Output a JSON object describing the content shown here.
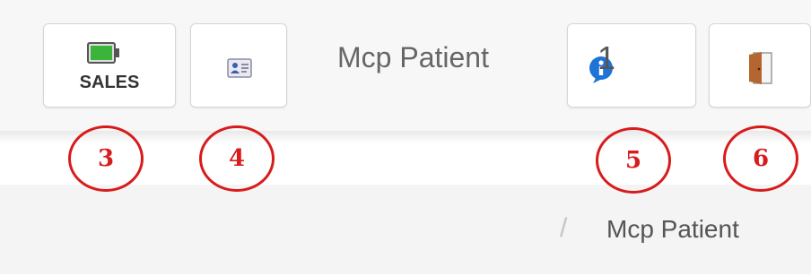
{
  "toolbar": {
    "sales_label": "SALES",
    "page_title": "Mcp Patient",
    "notification_count": "1"
  },
  "breadcrumb": {
    "separator": "/",
    "current": "Mcp Patient"
  },
  "annotations": [
    "3",
    "4",
    "5",
    "6"
  ],
  "icons": {
    "sales": "battery-icon",
    "contact": "id-card-icon",
    "info": "info-icon",
    "exit": "door-icon"
  },
  "colors": {
    "annotation": "#d81b1b",
    "info": "#1e73d6",
    "battery": "#3cb43c",
    "door": "#b5652e"
  }
}
